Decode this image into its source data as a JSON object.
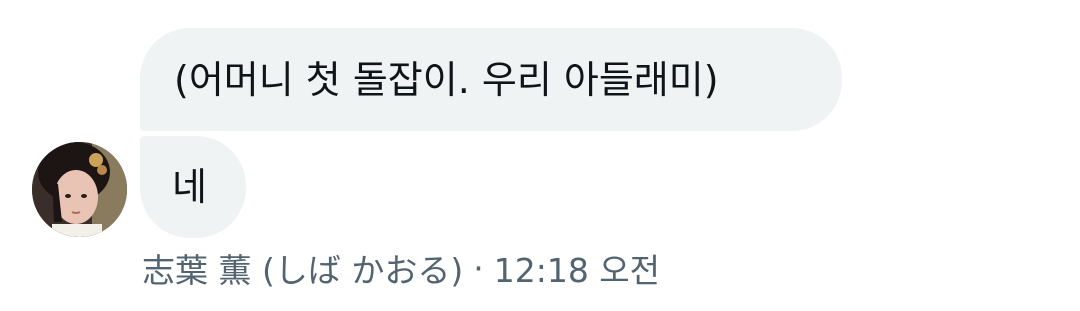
{
  "messages": [
    {
      "text": "(어머니 첫 돌잡이. 우리 아들래미)"
    },
    {
      "text": "네"
    }
  ],
  "sender": {
    "name": "志葉 薫 (しば かおる)",
    "avatar_icon": "user-avatar-photo"
  },
  "meta": {
    "separator": "·",
    "time": "12:18 오전"
  },
  "colors": {
    "bubble_bg": "#eff3f4",
    "text": "#0f1419",
    "meta_text": "#536471"
  }
}
